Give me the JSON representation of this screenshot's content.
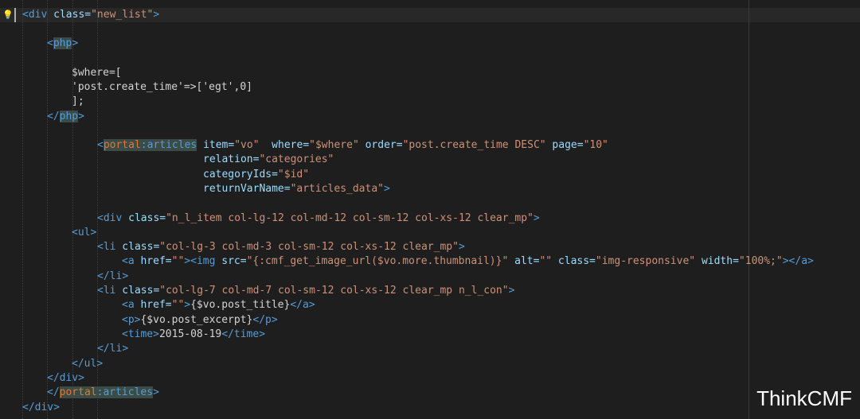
{
  "watermark": "ThinkCMF",
  "editor": {
    "lines": [
      [
        [
          "<",
          "tag"
        ],
        [
          "div",
          "tag"
        ],
        [
          " class=",
          "attr"
        ],
        [
          "\"new_list\"",
          "str"
        ],
        [
          ">",
          "tag"
        ]
      ],
      [],
      [
        [
          "<",
          "tag"
        ],
        [
          "php",
          "name"
        ],
        [
          ">",
          "tag"
        ]
      ],
      [],
      [
        [
          "$where=[",
          "txt"
        ]
      ],
      [
        [
          "'post.create_time'=>['egt',0]",
          "txt"
        ]
      ],
      [
        [
          "];",
          "txt"
        ]
      ],
      [
        [
          "</",
          "tag"
        ],
        [
          "php",
          "name"
        ],
        [
          ">",
          "tag"
        ]
      ],
      [],
      [
        [
          "<",
          "tag"
        ],
        [
          "portal",
          "ns"
        ],
        [
          ":articles",
          "name"
        ],
        [
          " item=",
          "attr"
        ],
        [
          "\"vo\"",
          "str"
        ],
        [
          "  where=",
          "attr"
        ],
        [
          "\"$where\"",
          "str"
        ],
        [
          " order=",
          "attr"
        ],
        [
          "\"post.create_time DESC\"",
          "str"
        ],
        [
          " page=",
          "attr"
        ],
        [
          "\"10\"",
          "str"
        ]
      ],
      [
        [
          "relation=",
          "attr"
        ],
        [
          "\"categories\"",
          "str"
        ]
      ],
      [
        [
          "categoryIds=",
          "attr"
        ],
        [
          "\"$id\"",
          "str"
        ]
      ],
      [
        [
          "returnVarName=",
          "attr"
        ],
        [
          "\"articles_data\"",
          "str"
        ],
        [
          ">",
          "tag"
        ]
      ],
      [],
      [
        [
          "<",
          "tag"
        ],
        [
          "div",
          "tag"
        ],
        [
          " class=",
          "attr"
        ],
        [
          "\"n_l_item col-lg-12 col-md-12 col-sm-12 col-xs-12 clear_mp\"",
          "str"
        ],
        [
          ">",
          "tag"
        ]
      ],
      [
        [
          "<",
          "tag"
        ],
        [
          "ul",
          "tag"
        ],
        [
          ">",
          "tag"
        ]
      ],
      [
        [
          "<",
          "tag"
        ],
        [
          "li",
          "tag"
        ],
        [
          " class=",
          "attr"
        ],
        [
          "\"col-lg-3 col-md-3 col-sm-12 col-xs-12 clear_mp\"",
          "str"
        ],
        [
          ">",
          "tag"
        ]
      ],
      [
        [
          "<",
          "tag"
        ],
        [
          "a",
          "tag"
        ],
        [
          " href=",
          "attr"
        ],
        [
          "\"\"",
          "str"
        ],
        [
          "><",
          "tag"
        ],
        [
          "img",
          "tag"
        ],
        [
          " src=",
          "attr"
        ],
        [
          "\"{:cmf_get_image_url($vo.more.thumbnail)}\"",
          "str"
        ],
        [
          " alt=",
          "attr"
        ],
        [
          "\"\"",
          "str"
        ],
        [
          " class=",
          "attr"
        ],
        [
          "\"img-responsive\"",
          "str"
        ],
        [
          " width=",
          "attr"
        ],
        [
          "\"100%;\"",
          "str"
        ],
        [
          "></",
          "tag"
        ],
        [
          "a",
          "tag"
        ],
        [
          ">",
          "tag"
        ]
      ],
      [
        [
          "</",
          "tag"
        ],
        [
          "li",
          "tag"
        ],
        [
          ">",
          "tag"
        ]
      ],
      [
        [
          "<",
          "tag"
        ],
        [
          "li",
          "tag"
        ],
        [
          " class=",
          "attr"
        ],
        [
          "\"col-lg-7 col-md-7 col-sm-12 col-xs-12 clear_mp n_l_con\"",
          "str"
        ],
        [
          ">",
          "tag"
        ]
      ],
      [
        [
          "<",
          "tag"
        ],
        [
          "a",
          "tag"
        ],
        [
          " href=",
          "attr"
        ],
        [
          "\"\"",
          "str"
        ],
        [
          ">",
          "tag"
        ],
        [
          "{$vo.post_title}",
          "txt"
        ],
        [
          "</",
          "tag"
        ],
        [
          "a",
          "tag"
        ],
        [
          ">",
          "tag"
        ]
      ],
      [
        [
          "<",
          "tag"
        ],
        [
          "p",
          "tag"
        ],
        [
          ">",
          "tag"
        ],
        [
          "{$vo.post_excerpt}",
          "txt"
        ],
        [
          "</",
          "tag"
        ],
        [
          "p",
          "tag"
        ],
        [
          ">",
          "tag"
        ]
      ],
      [
        [
          "<",
          "tag"
        ],
        [
          "time",
          "tag"
        ],
        [
          ">",
          "tag"
        ],
        [
          "2015-08-19",
          "txt"
        ],
        [
          "</",
          "tag"
        ],
        [
          "time",
          "tag"
        ],
        [
          ">",
          "tag"
        ]
      ],
      [
        [
          "</",
          "tag"
        ],
        [
          "li",
          "tag"
        ],
        [
          ">",
          "tag"
        ]
      ],
      [
        [
          "</",
          "tag"
        ],
        [
          "ul",
          "tag"
        ],
        [
          ">",
          "tag"
        ]
      ],
      [
        [
          "</",
          "tag"
        ],
        [
          "div",
          "tag"
        ],
        [
          ">",
          "tag"
        ]
      ],
      [
        [
          "</",
          "tag"
        ],
        [
          "portal",
          "ns"
        ],
        [
          ":articles",
          "name"
        ],
        [
          ">",
          "tag"
        ]
      ],
      [
        [
          "</",
          "tag"
        ],
        [
          "div",
          "tag"
        ],
        [
          ">",
          "tag"
        ]
      ]
    ]
  },
  "colors": {
    "background": "#1e1e1e",
    "tag": "#569cd6",
    "attribute": "#9cdcfe",
    "string": "#ce9178",
    "text": "#d4d4d4",
    "namespace": "#e0763a"
  }
}
